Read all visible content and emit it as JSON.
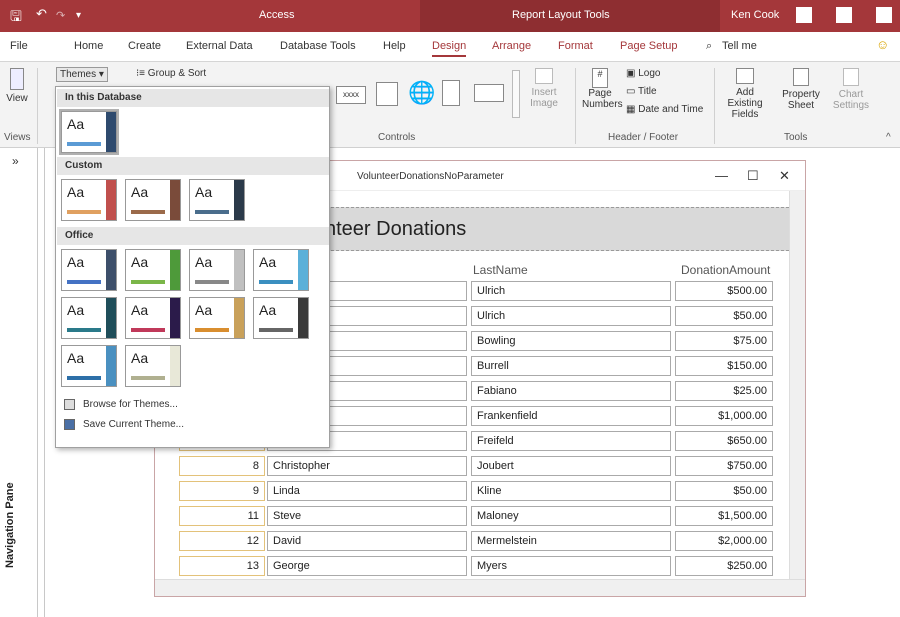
{
  "titlebar": {
    "app": "Access",
    "context": "Report Layout Tools",
    "user": "Ken Cook"
  },
  "tabs": [
    {
      "label": "File"
    },
    {
      "label": "Home"
    },
    {
      "label": "Create"
    },
    {
      "label": "External Data"
    },
    {
      "label": "Database Tools"
    },
    {
      "label": "Help"
    },
    {
      "label": "Design"
    },
    {
      "label": "Arrange"
    },
    {
      "label": "Format"
    },
    {
      "label": "Page Setup"
    }
  ],
  "tellme": "Tell me",
  "ribbon": {
    "view": "View",
    "views_group": "Views",
    "themes": "Themes",
    "group_sort": "Group & Sort",
    "controls_group": "Controls",
    "xxxx": "xxxx",
    "insert_image": "Insert Image",
    "page_numbers": "Page Numbers",
    "logo": "Logo",
    "title": "Title",
    "date_time": "Date and Time",
    "header_footer_group": "Header / Footer",
    "add_fields": "Add Existing Fields",
    "property_sheet": "Property Sheet",
    "chart_settings": "Chart Settings",
    "tools_group": "Tools"
  },
  "nav": {
    "label": "Navigation Pane",
    "chevron": "»"
  },
  "dropdown": {
    "sec_db": "In this Database",
    "sec_custom": "Custom",
    "sec_office": "Office",
    "browse": "Browse for Themes...",
    "save": "Save Current Theme...",
    "aa": "Aa"
  },
  "report": {
    "window_title": "VolunteerDonationsNoParameter",
    "header": "nteer Donations",
    "col_lastname": "LastName",
    "col_amount": "DonationAmount",
    "rows": [
      {
        "id": "",
        "first": "",
        "last": "Ulrich",
        "amt": "$500.00"
      },
      {
        "id": "",
        "first": "",
        "last": "Ulrich",
        "amt": "$50.00"
      },
      {
        "id": "",
        "first": "",
        "last": "Bowling",
        "amt": "$75.00"
      },
      {
        "id": "",
        "first": "",
        "last": "Burrell",
        "amt": "$150.00"
      },
      {
        "id": "",
        "first": "",
        "last": "Fabiano",
        "amt": "$25.00"
      },
      {
        "id": "",
        "first": "",
        "last": "Frankenfield",
        "amt": "$1,000.00"
      },
      {
        "id": "",
        "first": "",
        "last": "Freifeld",
        "amt": "$650.00"
      },
      {
        "id": "8",
        "first": "Christopher",
        "last": "Joubert",
        "amt": "$750.00"
      },
      {
        "id": "9",
        "first": "Linda",
        "last": "Kline",
        "amt": "$50.00"
      },
      {
        "id": "11",
        "first": "Steve",
        "last": "Maloney",
        "amt": "$1,500.00"
      },
      {
        "id": "12",
        "first": "David",
        "last": "Mermelstein",
        "amt": "$2,000.00"
      },
      {
        "id": "13",
        "first": "George",
        "last": "Myers",
        "amt": "$250.00"
      }
    ]
  }
}
